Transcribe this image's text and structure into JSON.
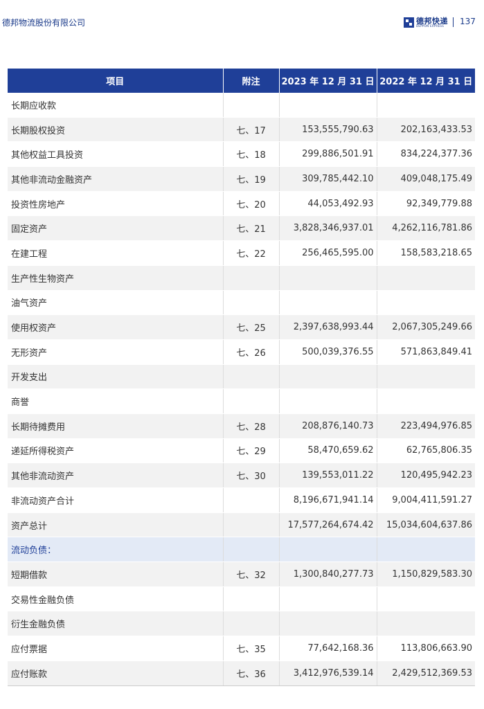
{
  "header": {
    "company": "德邦物流股份有限公司",
    "logo_cn": "德邦快递",
    "logo_en": "DEPPON EXPRESS",
    "page_number": "137",
    "brand_color": "#1f3f98"
  },
  "table": {
    "columns": [
      "项目",
      "附注",
      "2023 年 12 月 31 日",
      "2022 年 12 月 31 日"
    ],
    "rows": [
      {
        "item": "长期应收款",
        "note": "",
        "y2023": "",
        "y2022": ""
      },
      {
        "item": "长期股权投资",
        "note": "七、17",
        "y2023": "153,555,790.63",
        "y2022": "202,163,433.53"
      },
      {
        "item": "其他权益工具投资",
        "note": "七、18",
        "y2023": "299,886,501.91",
        "y2022": "834,224,377.36"
      },
      {
        "item": "其他非流动金融资产",
        "note": "七、19",
        "y2023": "309,785,442.10",
        "y2022": "409,048,175.49"
      },
      {
        "item": "投资性房地产",
        "note": "七、20",
        "y2023": "44,053,492.93",
        "y2022": "92,349,779.88"
      },
      {
        "item": "固定资产",
        "note": "七、21",
        "y2023": "3,828,346,937.01",
        "y2022": "4,262,116,781.86"
      },
      {
        "item": "在建工程",
        "note": "七、22",
        "y2023": "256,465,595.00",
        "y2022": "158,583,218.65"
      },
      {
        "item": "生产性生物资产",
        "note": "",
        "y2023": "",
        "y2022": ""
      },
      {
        "item": "油气资产",
        "note": "",
        "y2023": "",
        "y2022": ""
      },
      {
        "item": "使用权资产",
        "note": "七、25",
        "y2023": "2,397,638,993.44",
        "y2022": "2,067,305,249.66"
      },
      {
        "item": "无形资产",
        "note": "七、26",
        "y2023": "500,039,376.55",
        "y2022": "571,863,849.41"
      },
      {
        "item": "开发支出",
        "note": "",
        "y2023": "",
        "y2022": ""
      },
      {
        "item": "商誉",
        "note": "",
        "y2023": "",
        "y2022": ""
      },
      {
        "item": "长期待摊费用",
        "note": "七、28",
        "y2023": "208,876,140.73",
        "y2022": "223,494,976.85"
      },
      {
        "item": "递延所得税资产",
        "note": "七、29",
        "y2023": "58,470,659.62",
        "y2022": "62,765,806.35"
      },
      {
        "item": "其他非流动资产",
        "note": "七、30",
        "y2023": "139,553,011.22",
        "y2022": "120,495,942.23"
      },
      {
        "item": "非流动资产合计",
        "note": "",
        "y2023": "8,196,671,941.14",
        "y2022": "9,004,411,591.27"
      },
      {
        "item": "资产总计",
        "note": "",
        "y2023": "17,577,264,674.42",
        "y2022": "15,034,604,637.86"
      },
      {
        "item": "流动负债：",
        "note": "",
        "y2023": "",
        "y2022": "",
        "section": true
      },
      {
        "item": "短期借款",
        "note": "七、32",
        "y2023": "1,300,840,277.73",
        "y2022": "1,150,829,583.30"
      },
      {
        "item": "交易性金融负债",
        "note": "",
        "y2023": "",
        "y2022": ""
      },
      {
        "item": "衍生金融负债",
        "note": "",
        "y2023": "",
        "y2022": ""
      },
      {
        "item": "应付票据",
        "note": "七、35",
        "y2023": "77,642,168.36",
        "y2022": "113,806,663.90"
      },
      {
        "item": "应付账款",
        "note": "七、36",
        "y2023": "3,412,976,539.14",
        "y2022": "2,429,512,369.53"
      }
    ]
  }
}
